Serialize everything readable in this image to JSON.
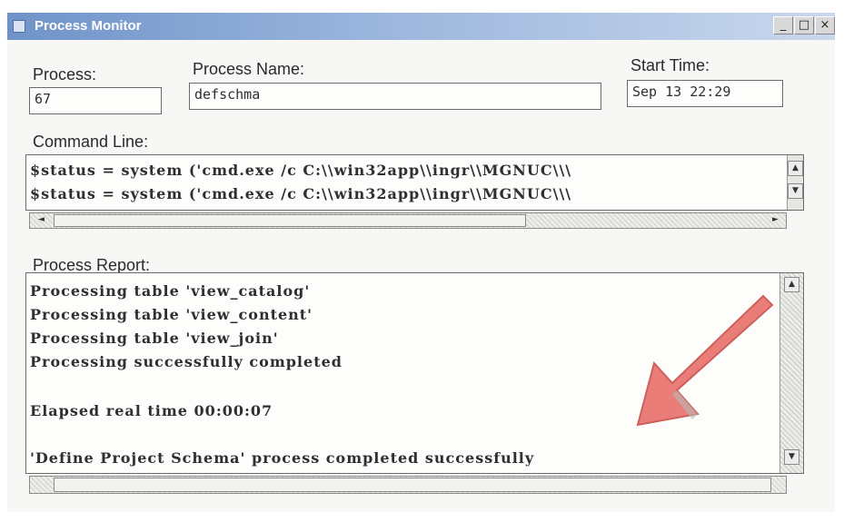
{
  "window": {
    "title": "Process Monitor",
    "controls": {
      "minimize": "_",
      "restore": "□",
      "close": "×"
    }
  },
  "process": {
    "label": "Process:",
    "value": "67"
  },
  "process_name": {
    "label": "Process Name:",
    "value": "defschma"
  },
  "start_time": {
    "label": "Start Time:",
    "value": "Sep 13 22:29"
  },
  "command_line": {
    "label": "Command Line:",
    "lines": [
      "$status = system ('cmd.exe /c C:\\\\win32app\\\\ingr\\\\MGNUC\\\\\\",
      "$status = system ('cmd.exe /c  C:\\\\win32app\\\\ingr\\\\MGNUC\\\\\\"
    ]
  },
  "process_report": {
    "label": "Process Report:",
    "lines": [
      "Processing table 'view_catalog'",
      "Processing table 'view_content'",
      "Processing table 'view_join'",
      "Processing successfully completed",
      "",
      "Elapsed real time     00:00:07",
      "",
      "'Define Project Schema' process completed successfully"
    ]
  },
  "scroll_glyphs": {
    "up": "▲",
    "down": "▼",
    "left": "◄",
    "right": "►"
  },
  "icons": {
    "highlight_arrow": "red-arrow-icon"
  },
  "colors": {
    "titlebar": "#6f93c9",
    "arrow": "#e8706a"
  }
}
